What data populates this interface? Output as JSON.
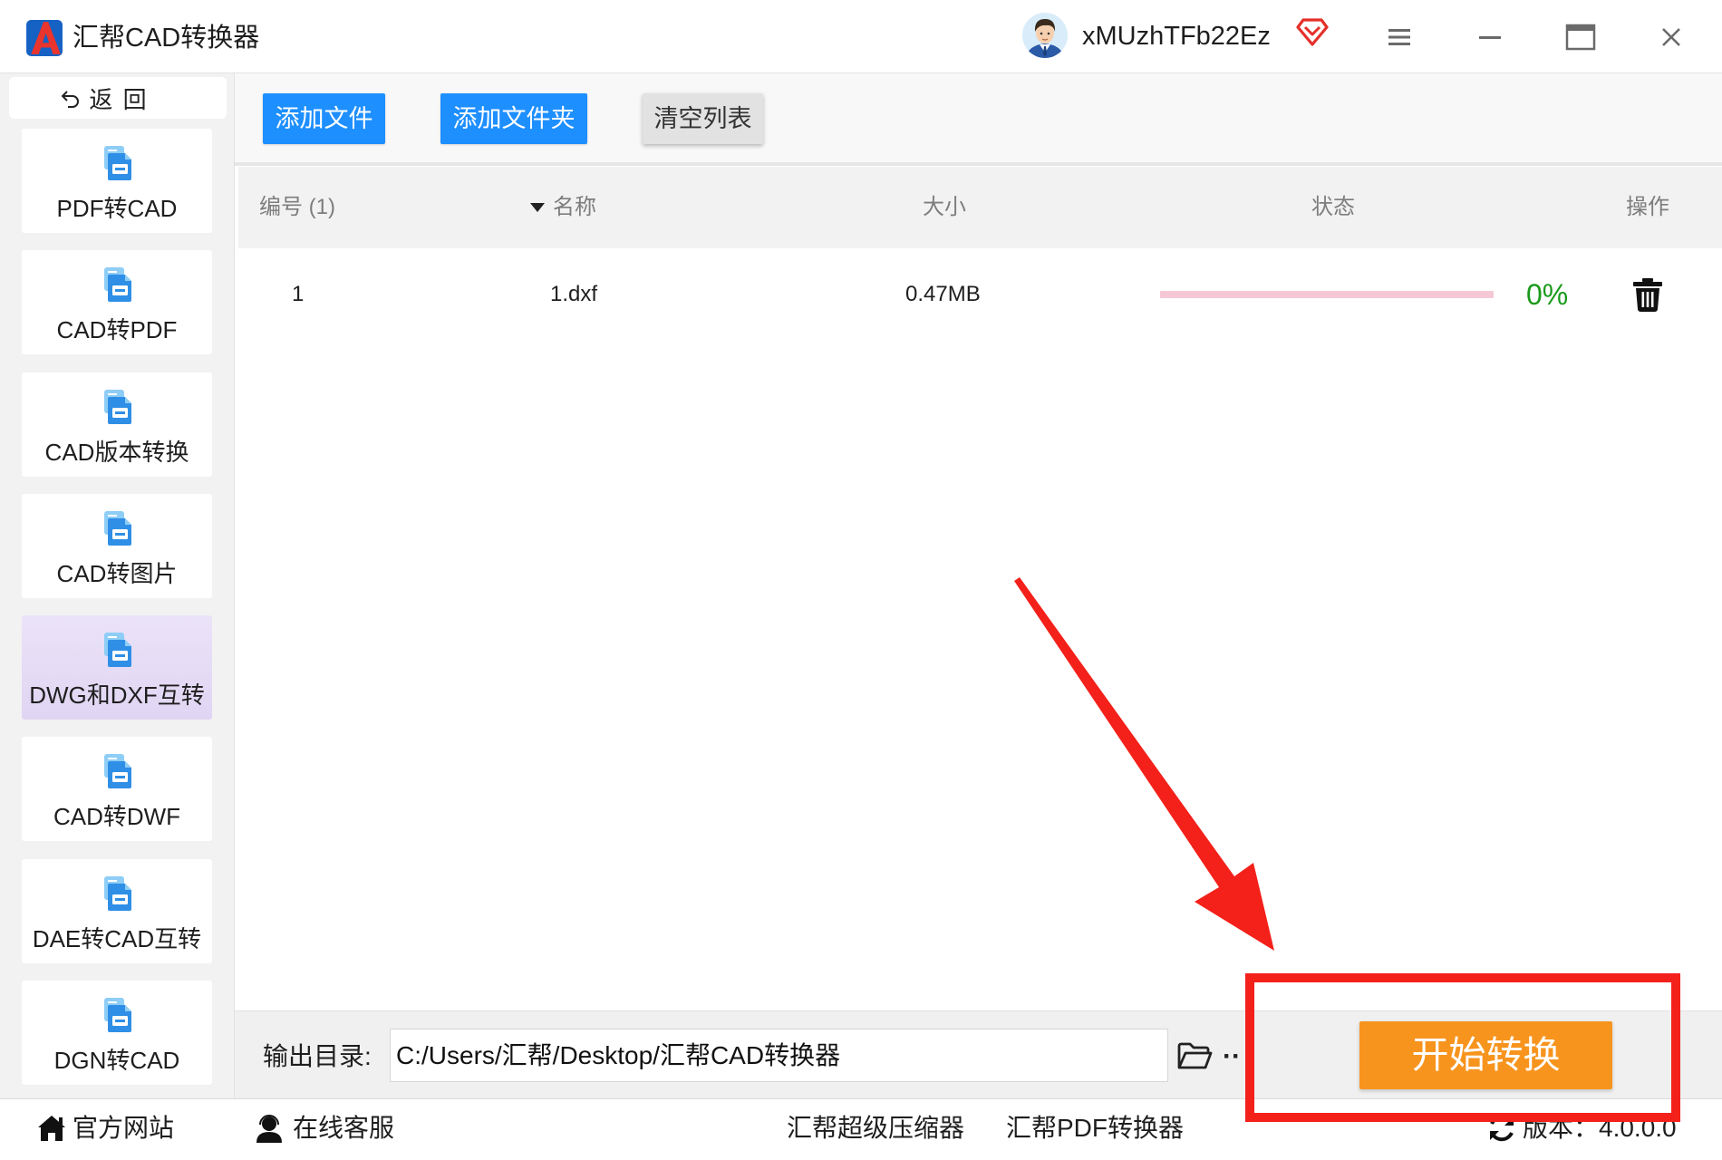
{
  "app": {
    "title": "汇帮CAD转换器",
    "logo_icon": "app-logo-icon"
  },
  "user": {
    "name": "xMUzhTFb22Ez",
    "avatar_icon": "avatar-icon",
    "vip_icon": "vip-diamond-icon"
  },
  "window_controls": {
    "menu_icon": "menu-icon",
    "minimize_icon": "minimize-icon",
    "maximize_icon": "maximize-icon",
    "close_icon": "close-icon"
  },
  "sidebar": {
    "back_label": "返 回",
    "back_icon": "back-arrow-icon",
    "items": [
      {
        "label": "PDF转CAD",
        "icon": "pdf-to-cad-icon",
        "selected": false
      },
      {
        "label": "CAD转PDF",
        "icon": "cad-to-pdf-icon",
        "selected": false
      },
      {
        "label": "CAD版本转换",
        "icon": "cad-version-icon",
        "selected": false
      },
      {
        "label": "CAD转图片",
        "icon": "cad-to-image-icon",
        "selected": false
      },
      {
        "label": "DWG和DXF互转",
        "icon": "dwg-dxf-icon",
        "selected": true
      },
      {
        "label": "CAD转DWF",
        "icon": "cad-to-dwf-icon",
        "selected": false
      },
      {
        "label": "DAE转CAD互转",
        "icon": "dae-cad-icon",
        "selected": false
      },
      {
        "label": "DGN转CAD",
        "icon": "dgn-to-cad-icon",
        "selected": false
      }
    ]
  },
  "toolbar": {
    "add_file": "添加文件",
    "add_folder": "添加文件夹",
    "clear_list": "清空列表"
  },
  "table": {
    "columns": [
      {
        "label": "编号 (1)"
      },
      {
        "label": "名称",
        "sort_icon": "sort-desc-icon"
      },
      {
        "label": "大小"
      },
      {
        "label": "状态"
      },
      {
        "label": "操作"
      }
    ],
    "rows": [
      {
        "index": "1",
        "name": "1.dxf",
        "size": "0.47MB",
        "progress": 0,
        "progress_label": "0%",
        "action_icon": "trash-icon"
      }
    ]
  },
  "output": {
    "label": "输出目录:",
    "path": "C:/Users/汇帮/Desktop/汇帮CAD转换器",
    "browse_icon": "folder-icon",
    "more_label": "··"
  },
  "start_button": {
    "label": "开始转换"
  },
  "footer": {
    "website": {
      "label": "官方网站",
      "icon": "home-icon"
    },
    "support": {
      "label": "在线客服",
      "icon": "support-icon"
    },
    "links": [
      "汇帮超级压缩器",
      "汇帮PDF转换器"
    ],
    "version": {
      "label": "版本：4.0.0.0",
      "icon": "refresh-icon"
    }
  },
  "colors": {
    "primary": "#1e8fff",
    "start": "#f7941e",
    "selected": "#e0d5f3",
    "progress_track": "#f6c8d5",
    "progress_text": "#1a9a1a",
    "annotation": "#f4201a"
  }
}
